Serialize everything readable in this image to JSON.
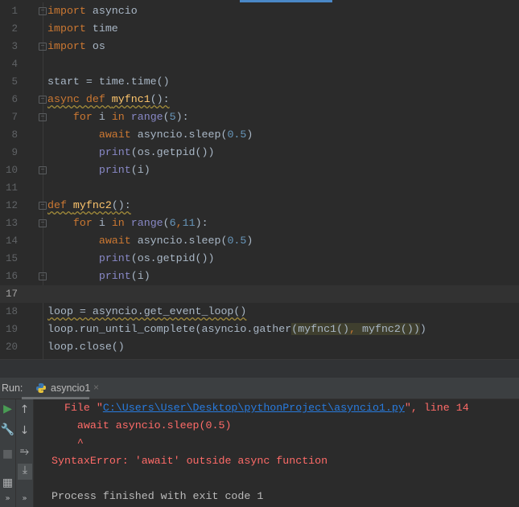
{
  "editor": {
    "current_line": 17,
    "lines": [
      {
        "n": "1",
        "fold": "top",
        "tokens": [
          [
            "import",
            "kw"
          ],
          [
            " asyncio",
            "tx"
          ]
        ]
      },
      {
        "n": "2",
        "tokens": [
          [
            "import",
            "kw"
          ],
          [
            " time",
            "tx"
          ]
        ]
      },
      {
        "n": "3",
        "fold": "end",
        "tokens": [
          [
            "import",
            "kw"
          ],
          [
            " os",
            "tx"
          ]
        ]
      },
      {
        "n": "4",
        "tokens": []
      },
      {
        "n": "5",
        "tokens": [
          [
            "start = time.time()",
            "tx"
          ]
        ]
      },
      {
        "n": "6",
        "fold": "top",
        "warn": true,
        "tokens": [
          [
            "async def ",
            "kw"
          ],
          [
            "myfnc1",
            "fn"
          ],
          [
            "():",
            "tx"
          ]
        ]
      },
      {
        "n": "7",
        "fold": "top",
        "tokens": [
          [
            "    for ",
            "kw"
          ],
          [
            "i ",
            "tx"
          ],
          [
            "in ",
            "kw"
          ],
          [
            "range",
            "bi"
          ],
          [
            "(",
            "tx"
          ],
          [
            "5",
            "nm"
          ],
          [
            "):",
            "tx"
          ]
        ]
      },
      {
        "n": "8",
        "tokens": [
          [
            "        await ",
            "kw"
          ],
          [
            "asyncio.sleep(",
            "tx"
          ],
          [
            "0.5",
            "nm"
          ],
          [
            ")",
            "tx"
          ]
        ]
      },
      {
        "n": "9",
        "tokens": [
          [
            "        print",
            "bi"
          ],
          [
            "(os.getpid())",
            "tx"
          ]
        ]
      },
      {
        "n": "10",
        "fold": "end",
        "tokens": [
          [
            "        print",
            "bi"
          ],
          [
            "(i)",
            "tx"
          ]
        ]
      },
      {
        "n": "11",
        "tokens": []
      },
      {
        "n": "12",
        "fold": "top",
        "warn": true,
        "tokens": [
          [
            "def ",
            "kw"
          ],
          [
            "myfnc2",
            "fn"
          ],
          [
            "():",
            "tx"
          ]
        ]
      },
      {
        "n": "13",
        "fold": "top",
        "tokens": [
          [
            "    for ",
            "kw"
          ],
          [
            "i ",
            "tx"
          ],
          [
            "in ",
            "kw"
          ],
          [
            "range",
            "bi"
          ],
          [
            "(",
            "tx"
          ],
          [
            "6",
            "nm"
          ],
          [
            ",",
            "kw"
          ],
          [
            "11",
            "nm"
          ],
          [
            "):",
            "tx"
          ]
        ]
      },
      {
        "n": "14",
        "tokens": [
          [
            "        await ",
            "kw"
          ],
          [
            "asyncio.sleep(",
            "tx"
          ],
          [
            "0.5",
            "nm"
          ],
          [
            ")",
            "tx"
          ]
        ]
      },
      {
        "n": "15",
        "tokens": [
          [
            "        print",
            "bi"
          ],
          [
            "(os.getpid())",
            "tx"
          ]
        ]
      },
      {
        "n": "16",
        "fold": "end",
        "tokens": [
          [
            "        print",
            "bi"
          ],
          [
            "(i)",
            "tx"
          ]
        ]
      },
      {
        "n": "17",
        "tokens": []
      },
      {
        "n": "18",
        "warn": true,
        "tokens": [
          [
            "loop = asyncio.get_event_loop()",
            "tx"
          ]
        ]
      },
      {
        "n": "19",
        "tokens": [
          [
            "loop.run_until_complete(asyncio.gather",
            "tx"
          ],
          [
            "(myfnc1()",
            "tx hl"
          ],
          [
            ",",
            "kw hl"
          ],
          [
            " myfnc2())",
            "tx hl"
          ],
          [
            ")",
            "tx"
          ]
        ]
      },
      {
        "n": "20",
        "tokens": [
          [
            "loop.close()",
            "tx"
          ]
        ]
      }
    ]
  },
  "run": {
    "label": "Run:",
    "tab_name": "asyncio1",
    "close_glyph": "×",
    "console": {
      "file_prefix": "  File \"",
      "file_path": "C:\\Users\\User\\Desktop\\pythonProject\\asyncio1.py",
      "file_suffix": "\", line 14",
      "code_line": "    await asyncio.sleep(0.5)",
      "caret": "    ^",
      "error": "SyntaxError: 'await' outside async function",
      "exit": "Process finished with exit code 1"
    }
  },
  "colors": {
    "keyword": "#cc7832",
    "text": "#a9b7c6",
    "builtin": "#8888c6",
    "number": "#6897bb",
    "function": "#ffc66d",
    "error": "#ff6b68",
    "link": "#287bde"
  }
}
